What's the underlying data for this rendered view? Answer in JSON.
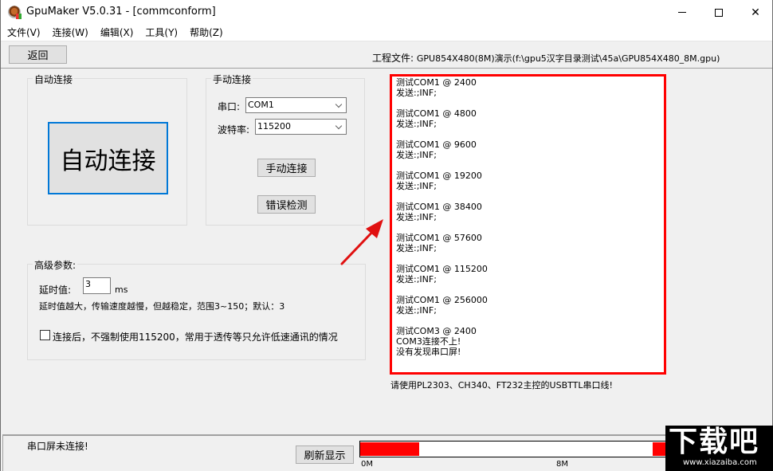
{
  "window": {
    "title": "GpuMaker V5.0.31 - [commconform]",
    "controls": {
      "minimize": "minimize",
      "maximize": "maximize",
      "close": "close"
    }
  },
  "menu": {
    "items": [
      {
        "label": "文件(V)"
      },
      {
        "label": "连接(W)"
      },
      {
        "label": "编辑(X)"
      },
      {
        "label": "工具(Y)"
      },
      {
        "label": "帮助(Z)"
      }
    ]
  },
  "toolbar": {
    "back_label": "返回",
    "project_label": "工程文件:",
    "project_path": "GPU854X480(8M)演示(f:\\gpu5汉字目录测试\\45a\\GPU854X480_8M.gpu)"
  },
  "auto_connect": {
    "group_title": "自动连接",
    "button_label": "自动连接"
  },
  "manual_connect": {
    "group_title": "手动连接",
    "port_label": "串口:",
    "port_value": "COM1",
    "baud_label": "波特率:",
    "baud_value": "115200",
    "connect_button": "手动连接",
    "error_check_button": "错误检测"
  },
  "advanced": {
    "group_title": "高级参数:",
    "delay_label": "延时值:",
    "delay_value": "3",
    "delay_unit": "ms",
    "delay_hint": "延时值越大，传输速度越慢，但越稳定，范围3~150；默认：3",
    "force_baud_checked": false,
    "force_baud_label": "连接后，不强制使用115200，常用于透传等只允许低速通讯的情况"
  },
  "log": {
    "lines": [
      "测试COM1 @ 2400",
      "发送:;INF;",
      "",
      "测试COM1 @ 4800",
      "发送:;INF;",
      "",
      "测试COM1 @ 9600",
      "发送:;INF;",
      "",
      "测试COM1 @ 19200",
      "发送:;INF;",
      "",
      "测试COM1 @ 38400",
      "发送:;INF;",
      "",
      "测试COM1 @ 57600",
      "发送:;INF;",
      "",
      "测试COM1 @ 115200",
      "发送:;INF;",
      "",
      "测试COM1 @ 256000",
      "发送:;INF;",
      "",
      "测试COM3 @ 2400",
      "COM3连接不上!",
      "没有发现串口屏!"
    ],
    "border_color": "#ff0000",
    "hint": "请使用PL2303、CH340、FT232主控的USBTTL串口线!"
  },
  "status": {
    "text": "串口屏未连接!",
    "refresh_button": "刷新显示",
    "memory_bar": {
      "fill_color": "#ff0000",
      "used_segments": [
        {
          "start_fraction": 0.0,
          "end_fraction": 0.19
        },
        {
          "start_fraction": 0.945,
          "end_fraction": 1.0
        }
      ],
      "tick_labels": [
        "0M",
        "8M"
      ]
    }
  },
  "watermark": {
    "logo_text": "下载吧",
    "url": "www.xiazaiba.com"
  }
}
